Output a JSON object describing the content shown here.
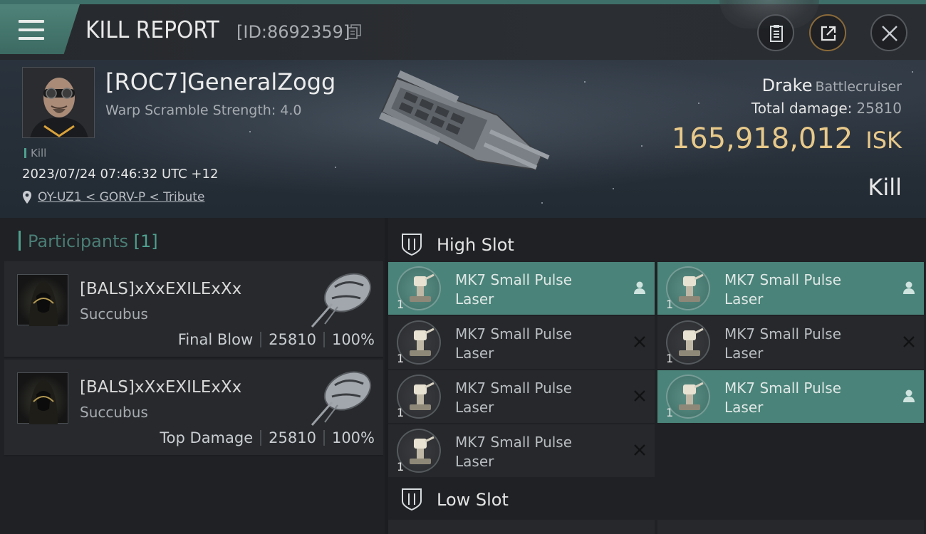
{
  "header": {
    "title": "KILL REPORT",
    "report_id": "[ID:8692359]"
  },
  "victim": {
    "name": "[ROC7]GeneralZogg",
    "subtitle": "Warp Scramble Strength: 4.0",
    "type_tag": "Kill",
    "datetime": "2023/07/24 07:46:32 UTC +12",
    "location": "OY-UZ1 < GORV-P < Tribute",
    "ship_name": "Drake",
    "ship_class": "Battlecruiser",
    "damage_label": "Total damage:",
    "damage_value": "25810",
    "isk_value": "165,918,012",
    "isk_unit": "ISK",
    "result": "Kill"
  },
  "participants": {
    "label": "Participants",
    "count": "[1]",
    "rows": [
      {
        "name": "[BALS]xXxEXILExXx",
        "ship": "Succubus",
        "role": "Final Blow",
        "damage": "25810",
        "percent": "100%"
      },
      {
        "name": "[BALS]xXxEXILExXx",
        "ship": "Succubus",
        "role": "Top Damage",
        "damage": "25810",
        "percent": "100%"
      }
    ]
  },
  "slots": {
    "high_label": "High Slot",
    "low_label": "Low Slot",
    "high": [
      {
        "name": "MK7 Small Pulse Laser",
        "qty": "1",
        "status": "dropped"
      },
      {
        "name": "MK7 Small Pulse Laser",
        "qty": "1",
        "status": "dropped"
      },
      {
        "name": "MK7 Small Pulse Laser",
        "qty": "1",
        "status": "destroyed"
      },
      {
        "name": "MK7 Small Pulse Laser",
        "qty": "1",
        "status": "destroyed"
      },
      {
        "name": "MK7 Small Pulse Laser",
        "qty": "1",
        "status": "destroyed"
      },
      {
        "name": "MK7 Small Pulse Laser",
        "qty": "1",
        "status": "dropped"
      },
      {
        "name": "MK7 Small Pulse Laser",
        "qty": "1",
        "status": "destroyed"
      }
    ]
  },
  "icons": {
    "menu": "hamburger-icon",
    "copy": "copy-icon",
    "clipboard": "clipboard-icon",
    "share": "share-icon",
    "close": "close-icon",
    "location": "location-pin-icon",
    "slot": "shield-slot-icon",
    "dropped": "person-icon",
    "destroyed": "x-icon"
  },
  "colors": {
    "accent": "#4fa08f",
    "dropped_bg": "#4a8379",
    "isk": "#e8c98a"
  }
}
